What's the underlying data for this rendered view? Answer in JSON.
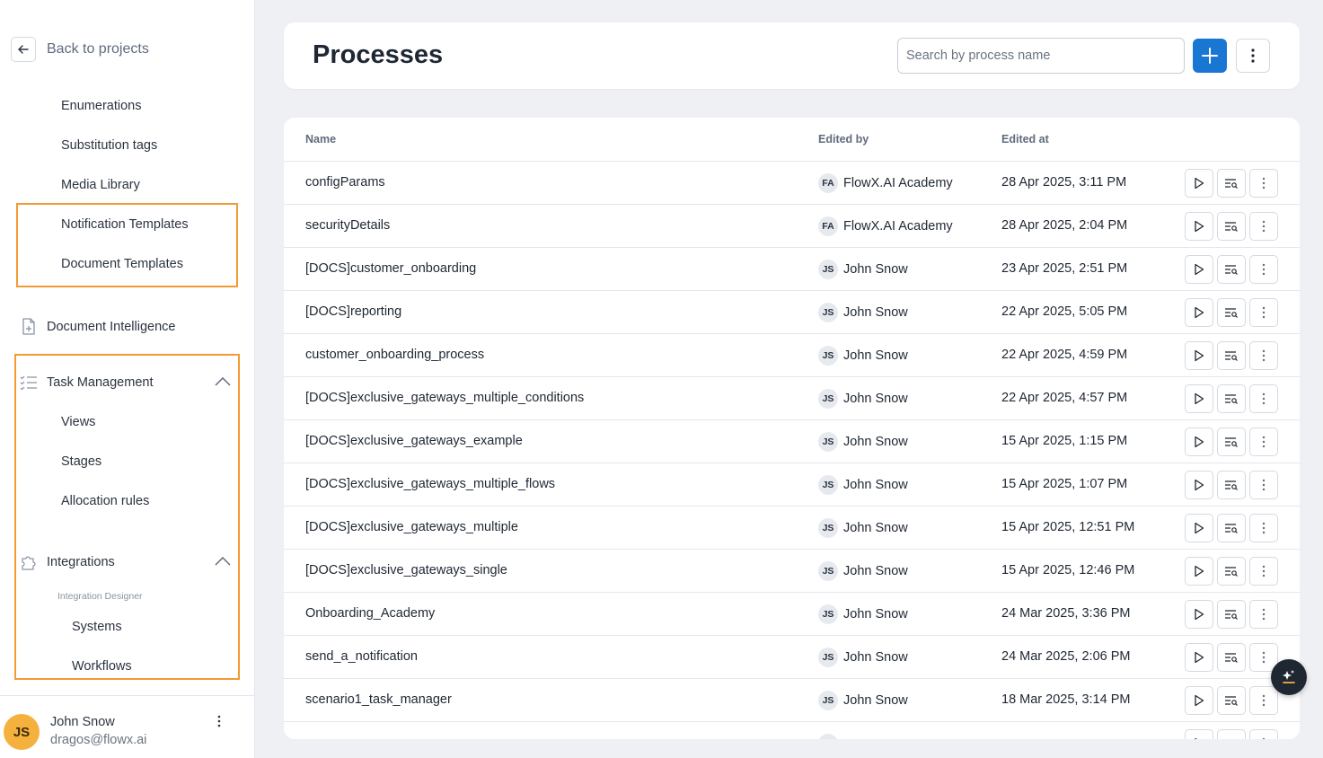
{
  "sidebar": {
    "back_label": "Back to projects",
    "items_top": [
      "Enumerations",
      "Substitution tags",
      "Media Library",
      "Notification Templates",
      "Document Templates"
    ],
    "document_intelligence": "Document Intelligence",
    "task_management": {
      "label": "Task Management",
      "children": [
        "Views",
        "Stages",
        "Allocation rules"
      ]
    },
    "integrations": {
      "label": "Integrations",
      "caption": "Integration Designer",
      "children": [
        "Systems",
        "Workflows"
      ]
    },
    "highlight_color": "#f39a33",
    "user": {
      "initials": "JS",
      "name": "John Snow",
      "email": "dragos@flowx.ai",
      "avatar_color": "#f5b13d"
    }
  },
  "header": {
    "title": "Processes",
    "search_placeholder": "Search by process name",
    "add_icon": "plus-icon",
    "more_icon": "kebab-icon",
    "accent": "#1976d2"
  },
  "table": {
    "columns": [
      "Name",
      "Edited by",
      "Edited at"
    ],
    "rows": [
      {
        "name": "configParams",
        "initials": "FA",
        "editor": "FlowX.AI Academy",
        "date": "28 Apr 2025, 3:11 PM"
      },
      {
        "name": "securityDetails",
        "initials": "FA",
        "editor": "FlowX.AI Academy",
        "date": "28 Apr 2025, 2:04 PM"
      },
      {
        "name": "[DOCS]customer_onboarding",
        "initials": "JS",
        "editor": "John Snow",
        "date": "23 Apr 2025, 2:51 PM"
      },
      {
        "name": "[DOCS]reporting",
        "initials": "JS",
        "editor": "John Snow",
        "date": "22 Apr 2025, 5:05 PM"
      },
      {
        "name": "customer_onboarding_process",
        "initials": "JS",
        "editor": "John Snow",
        "date": "22 Apr 2025, 4:59 PM"
      },
      {
        "name": "[DOCS]exclusive_gateways_multiple_conditions",
        "initials": "JS",
        "editor": "John Snow",
        "date": "22 Apr 2025, 4:57 PM"
      },
      {
        "name": "[DOCS]exclusive_gateways_example",
        "initials": "JS",
        "editor": "John Snow",
        "date": "15 Apr 2025, 1:15 PM"
      },
      {
        "name": "[DOCS]exclusive_gateways_multiple_flows",
        "initials": "JS",
        "editor": "John Snow",
        "date": "15 Apr 2025, 1:07 PM"
      },
      {
        "name": "[DOCS]exclusive_gateways_multiple",
        "initials": "JS",
        "editor": "John Snow",
        "date": "15 Apr 2025, 12:51 PM"
      },
      {
        "name": "[DOCS]exclusive_gateways_single",
        "initials": "JS",
        "editor": "John Snow",
        "date": "15 Apr 2025, 12:46 PM"
      },
      {
        "name": "Onboarding_Academy",
        "initials": "JS",
        "editor": "John Snow",
        "date": "24 Mar 2025, 3:36 PM"
      },
      {
        "name": "send_a_notification",
        "initials": "JS",
        "editor": "John Snow",
        "date": "24 Mar 2025, 2:06 PM"
      },
      {
        "name": "scenario1_task_manager",
        "initials": "JS",
        "editor": "John Snow",
        "date": "18 Mar 2025, 3:14 PM"
      },
      {
        "name": "",
        "initials": "",
        "editor": "",
        "date": ""
      }
    ],
    "row_actions": [
      "play-icon",
      "inspect-icon",
      "kebab-icon"
    ]
  },
  "assistant_fab_icon": "sparkle-icon"
}
